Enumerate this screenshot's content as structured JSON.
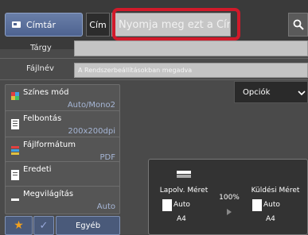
{
  "header": {
    "address_book_label": "Címtár",
    "subject_tab_label": "Cím",
    "title_placeholder": "Nyomja meg ezt a Cím"
  },
  "fields": {
    "subject_label": "Tárgy",
    "subject_value": "",
    "filename_label": "Fájlnév",
    "filename_placeholder": "A Rendszerbeállításokban megadva"
  },
  "options_button_label": "Opciók",
  "settings": [
    {
      "label": "Színes mód",
      "value": "Auto/Mono2"
    },
    {
      "label": "Felbontás",
      "value": "200x200dpi"
    },
    {
      "label": "Fájlformátum",
      "value": "PDF"
    },
    {
      "label": "Eredeti",
      "value": ""
    },
    {
      "label": "Megvilágítás",
      "value": "Auto"
    }
  ],
  "size_panel": {
    "original_size_label": "Lapolv. Méret",
    "original_size_value": "Auto",
    "original_paper": "A4",
    "ratio": "100%",
    "send_size_label": "Küldési Méret",
    "send_size_value": "Auto",
    "send_paper": "A4"
  },
  "bottom": {
    "other_label": "Egyéb"
  },
  "colors": {
    "accent_highlight": "#d11a2a",
    "value_text": "#a6b6d6",
    "button_blue": "#4e6390"
  }
}
